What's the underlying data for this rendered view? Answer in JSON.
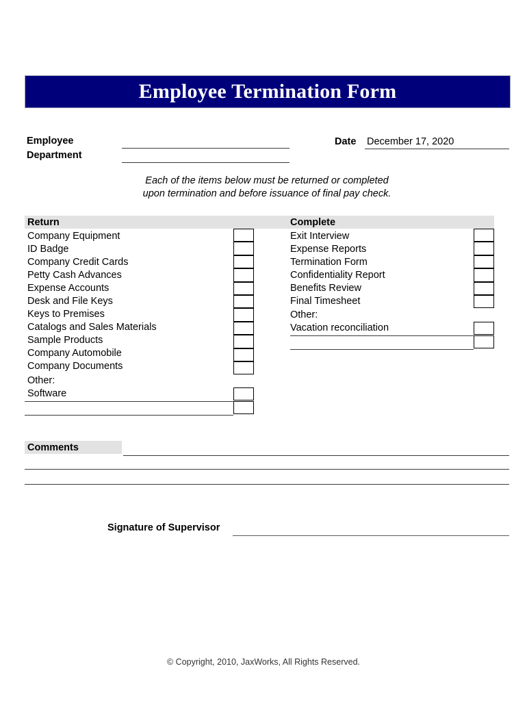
{
  "document": {
    "title": "Employee Termination Form"
  },
  "header": {
    "employee_label": "Employee",
    "department_label": "Department",
    "employee_value": "",
    "department_value": "",
    "date_label": "Date",
    "date_value": "December 17, 2020"
  },
  "instruction": {
    "line1": "Each of the items below must be returned or completed",
    "line2": "upon termination and before issuance of final pay check."
  },
  "columns": {
    "return": {
      "header": "Return",
      "items": [
        {
          "label": "Company Equipment",
          "checked": false
        },
        {
          "label": "ID Badge",
          "checked": false
        },
        {
          "label": "Company Credit Cards",
          "checked": false
        },
        {
          "label": "Petty Cash Advances",
          "checked": false
        },
        {
          "label": "Expense Accounts",
          "checked": false
        },
        {
          "label": "Desk and File Keys",
          "checked": false
        },
        {
          "label": "Keys to Premises",
          "checked": false
        },
        {
          "label": "Catalogs and Sales Materials",
          "checked": false
        },
        {
          "label": "Sample Products",
          "checked": false
        },
        {
          "label": "Company Automobile",
          "checked": false
        },
        {
          "label": "Company Documents",
          "checked": false
        }
      ],
      "other_label": "Other:",
      "other_entries": [
        {
          "label": "Software",
          "checked": false
        },
        {
          "label": "",
          "checked": false
        }
      ]
    },
    "complete": {
      "header": "Complete",
      "items": [
        {
          "label": "Exit Interview",
          "checked": false
        },
        {
          "label": "Expense Reports",
          "checked": false
        },
        {
          "label": "Termination Form",
          "checked": false
        },
        {
          "label": "Confidentiality Report",
          "checked": false
        },
        {
          "label": "Benefits Review",
          "checked": false
        },
        {
          "label": "Final Timesheet",
          "checked": false
        }
      ],
      "other_label": "Other:",
      "other_entries": [
        {
          "label": "Vacation reconciliation",
          "checked": false
        },
        {
          "label": "",
          "checked": false
        }
      ]
    }
  },
  "comments": {
    "label": "Comments",
    "line1_value": "",
    "line2_value": "",
    "line3_value": ""
  },
  "signature": {
    "label": "Signature of Supervisor",
    "value": ""
  },
  "footer": {
    "copyright": "© Copyright, 2010, JaxWorks, All Rights Reserved."
  },
  "colors": {
    "banner": "#00007B",
    "banner_text": "#FFFFFF",
    "section_header_bg": "#E2E2E2",
    "rule": "#3A3A3A"
  }
}
